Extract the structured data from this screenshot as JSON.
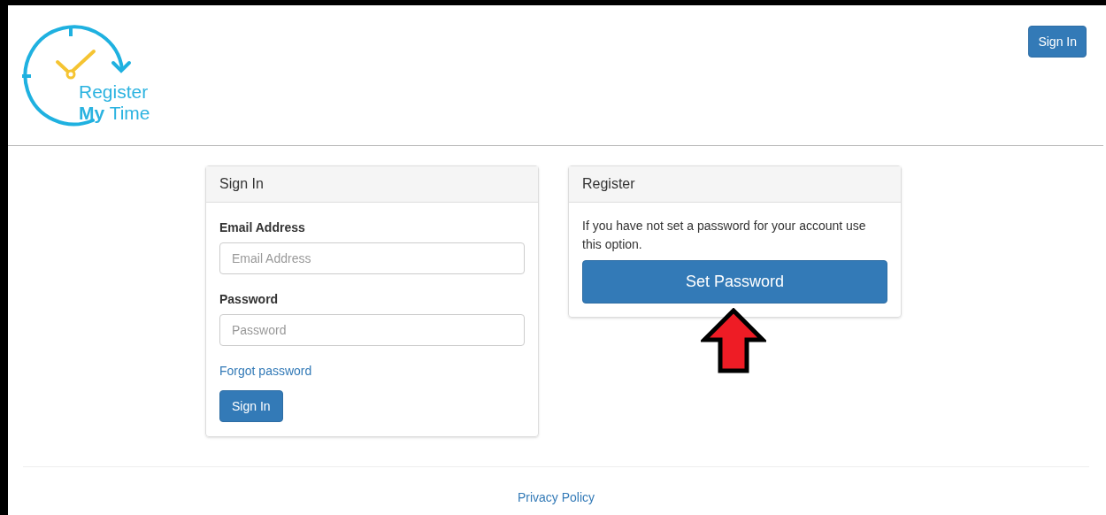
{
  "header": {
    "logo": {
      "line1": "Register",
      "line2_bold": "My",
      "line2_rest": "Time"
    },
    "sign_in_button": "Sign In"
  },
  "sign_in_panel": {
    "title": "Sign In",
    "email_label": "Email Address",
    "email_placeholder": "Email Address",
    "password_label": "Password",
    "password_placeholder": "Password",
    "forgot_link": "Forgot password",
    "submit": "Sign In"
  },
  "register_panel": {
    "title": "Register",
    "text": "If you have not set a password for your account use this option.",
    "button": "Set Password"
  },
  "footer": {
    "link": "Privacy Policy"
  }
}
